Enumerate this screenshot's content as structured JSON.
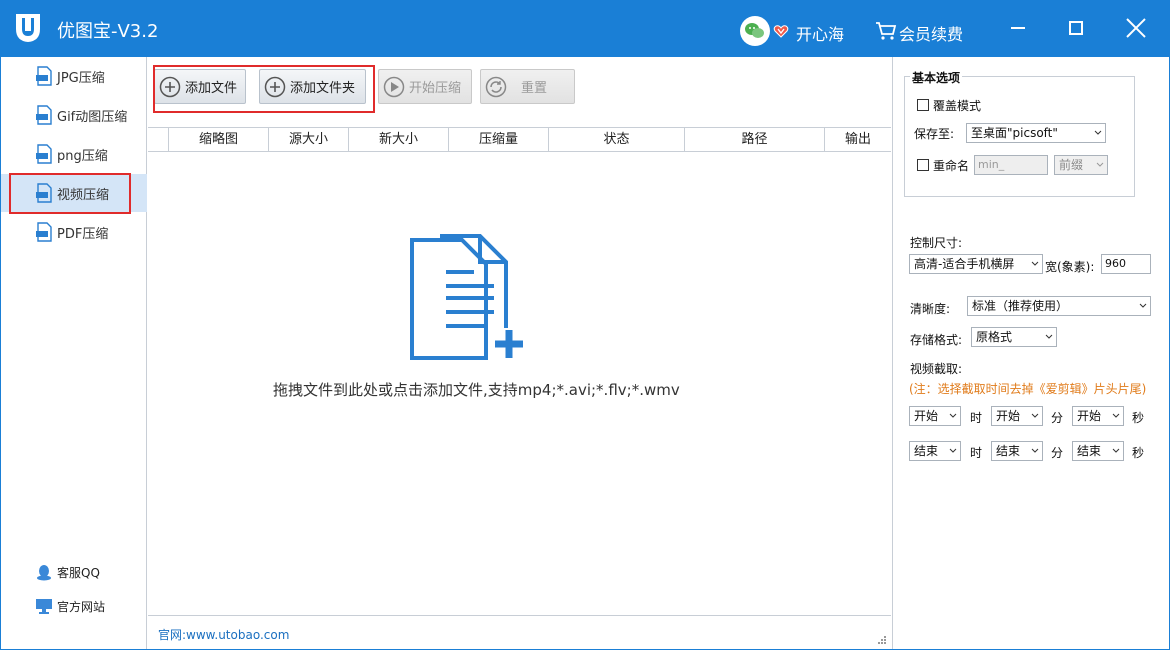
{
  "window": {
    "title": "优图宝-V3.2",
    "username": "开心海",
    "renew_label": "会员续费",
    "accent": "#1a7fd6"
  },
  "sidebar": {
    "items": [
      {
        "label": "JPG压缩",
        "icon": "jpg-file-icon"
      },
      {
        "label": "Gif动图压缩",
        "icon": "gif-file-icon"
      },
      {
        "label": "png压缩",
        "icon": "png-file-icon"
      },
      {
        "label": "视频压缩",
        "icon": "video-file-icon",
        "active": true
      },
      {
        "label": "PDF压缩",
        "icon": "pdf-file-icon"
      }
    ],
    "bottom": [
      {
        "label": "客服QQ",
        "icon": "qq-penguin-icon"
      },
      {
        "label": "官方网站",
        "icon": "monitor-icon"
      }
    ]
  },
  "toolbar": {
    "add_file": "添加文件",
    "add_folder": "添加文件夹",
    "start": "开始压缩",
    "reset": "重置"
  },
  "table": {
    "columns": [
      "",
      "缩略图",
      "源大小",
      "新大小",
      "压缩量",
      "状态",
      "路径",
      "输出"
    ]
  },
  "drop_zone": {
    "hint": "拖拽文件到此处或点击添加文件,支持mp4;*.avi;*.flv;*.wmv"
  },
  "footer": {
    "link": "官网:www.utobao.com"
  },
  "options": {
    "basic_title": "基本选项",
    "overwrite_label": "覆盖模式",
    "overwrite_checked": false,
    "save_to_label": "保存至:",
    "save_to_value": "至桌面\"picsoft\"",
    "rename_label": "重命名",
    "rename_checked": false,
    "rename_placeholder": "min_",
    "rename_position": "前缀",
    "size_label": "控制尺寸:",
    "size_value": "高清-适合手机横屏",
    "width_label": "宽(象素):",
    "width_value": "960",
    "clarity_label": "清晰度:",
    "clarity_value": "标准（推荐使用）",
    "format_label": "存储格式:",
    "format_value": "原格式",
    "clip_label": "视频截取:",
    "clip_note": "(注：选择截取时间去掉《爱剪辑》片头片尾)",
    "start_row": {
      "h": "开始",
      "m": "开始",
      "s": "开始"
    },
    "end_row": {
      "h": "结束",
      "m": "结束",
      "s": "结束"
    },
    "unit_h": "时",
    "unit_m": "分",
    "unit_s": "秒"
  }
}
